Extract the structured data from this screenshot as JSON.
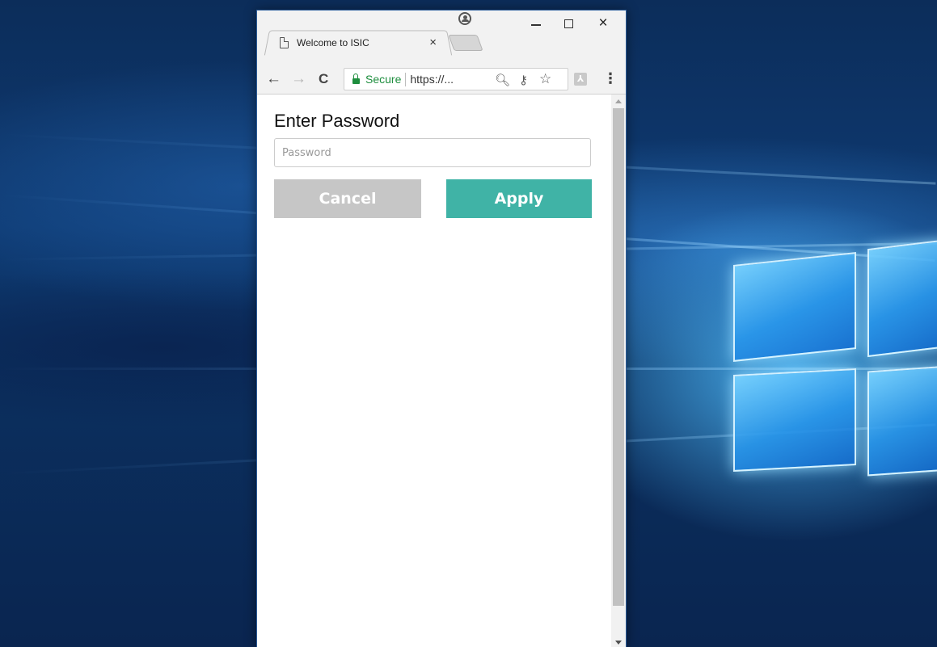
{
  "browser": {
    "tab_title": "Welcome to ISIC",
    "tab_close": "×",
    "window_controls": {
      "close": "×"
    },
    "nav": {
      "back": "←",
      "forward": "→",
      "reload": "C"
    },
    "omnibox": {
      "secure_label": "Secure",
      "url": "https://...",
      "icons": [
        "zoom-icon",
        "key-icon",
        "star-icon"
      ],
      "secure_color": "#1e8e3e"
    },
    "menu": "⋮"
  },
  "page": {
    "title": "Enter Password",
    "password_field": {
      "placeholder": "Password",
      "value": ""
    },
    "cancel_label": "Cancel",
    "apply_label": "Apply"
  },
  "colors": {
    "apply_button": "#40b3a6",
    "cancel_button": "#c6c6c6",
    "desktop": "#0e3a72"
  }
}
